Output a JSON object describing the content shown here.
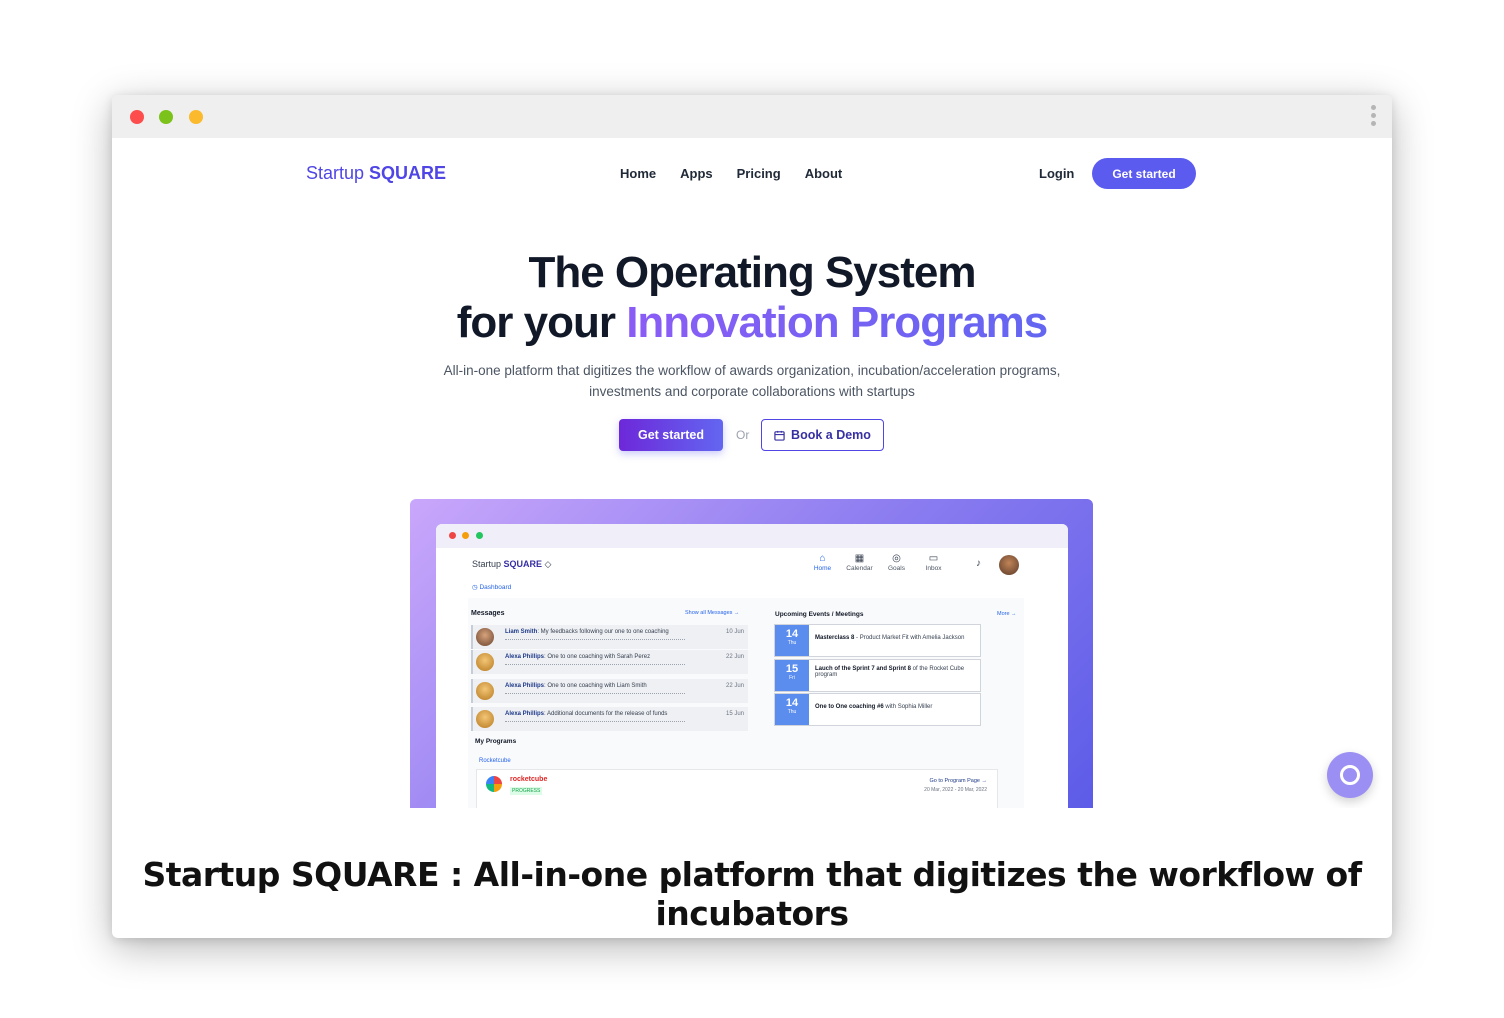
{
  "nav": {
    "logo_regular": "Startup ",
    "logo_bold": "SQUARE",
    "links": [
      "Home",
      "Apps",
      "Pricing",
      "About"
    ],
    "login": "Login",
    "cta": "Get started"
  },
  "hero": {
    "title_line1": "The Operating System",
    "title_line2_prefix": "for your ",
    "title_line2_accent": "Innovation Programs",
    "subtitle": "All-in-one platform that digitizes the workflow of awards organization, incubation/acceleration programs, investments and corporate collaborations with startups",
    "primary_cta": "Get started",
    "or": "Or",
    "demo_cta": "Book a Demo"
  },
  "mockup": {
    "logo_regular": "Startup ",
    "logo_bold": "SQUARE",
    "nav": [
      "Home",
      "Calendar",
      "Goals",
      "Inbox"
    ],
    "breadcrumb": "Dashboard",
    "messages_title": "Messages",
    "messages_link": "Show all Messages →",
    "messages": [
      {
        "name": "Liam Smith",
        "text": ": My feedbacks following our one to one coaching",
        "date": "10 Jun"
      },
      {
        "name": "Alexa Phillips",
        "text": ": One to one coaching with Sarah Perez",
        "date": "22 Jun"
      },
      {
        "name": "Alexa Phillips",
        "text": ": One to one coaching with Liam Smith",
        "date": "22 Jun"
      },
      {
        "name": "Alexa Phillips",
        "text": ": Additional documents for the release of funds",
        "date": "15 Jun"
      }
    ],
    "events_title": "Upcoming Events / Meetings",
    "events_link": "More →",
    "events": [
      {
        "day": "14",
        "weekday": "Thu",
        "bold": "Masterclass 8",
        "text": " - Product Market Fit with Amelia Jackson"
      },
      {
        "day": "15",
        "weekday": "Fri",
        "bold": "Lauch of the Sprint 7 and Sprint 8",
        "text": " of the Rocket Cube program"
      },
      {
        "day": "14",
        "weekday": "Thu",
        "bold": "One to One coaching #6",
        "text": " with Sophia Miller"
      }
    ],
    "programs_title": "My Programs",
    "program_tab": "Rocketcube",
    "program_name": "rocketcube",
    "program_badge": "PROGRESS",
    "program_link": "Go to Program Page →",
    "program_dates": "20 Mar, 2022 - 20 Mar, 2022"
  },
  "caption": "Startup SQUARE : All-in-one platform that digitizes the workflow of incubators"
}
